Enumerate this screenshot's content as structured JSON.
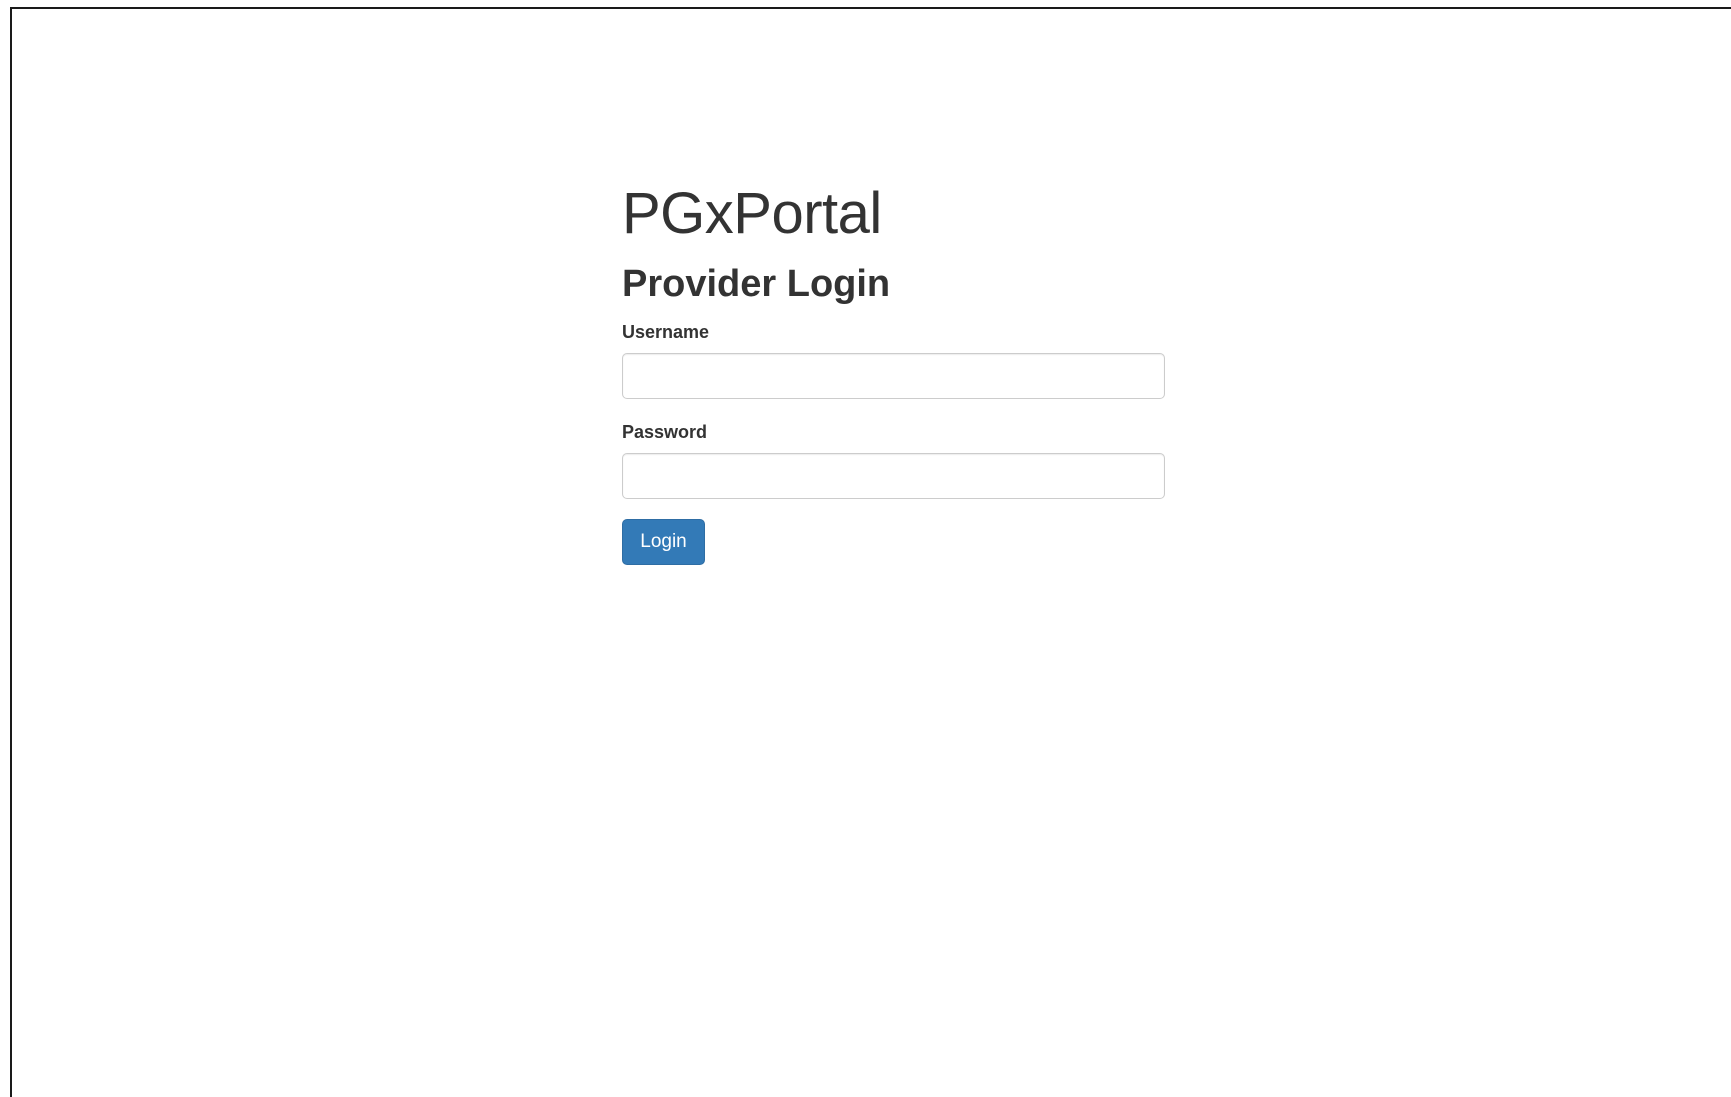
{
  "app": {
    "title": "PGxPortal"
  },
  "login_form": {
    "heading": "Provider Login",
    "username": {
      "label": "Username",
      "value": "",
      "placeholder": ""
    },
    "password": {
      "label": "Password",
      "value": "",
      "placeholder": ""
    },
    "submit_label": "Login"
  },
  "colors": {
    "primary_button": "#337ab7",
    "text": "#333333",
    "input_border": "#cccccc"
  }
}
